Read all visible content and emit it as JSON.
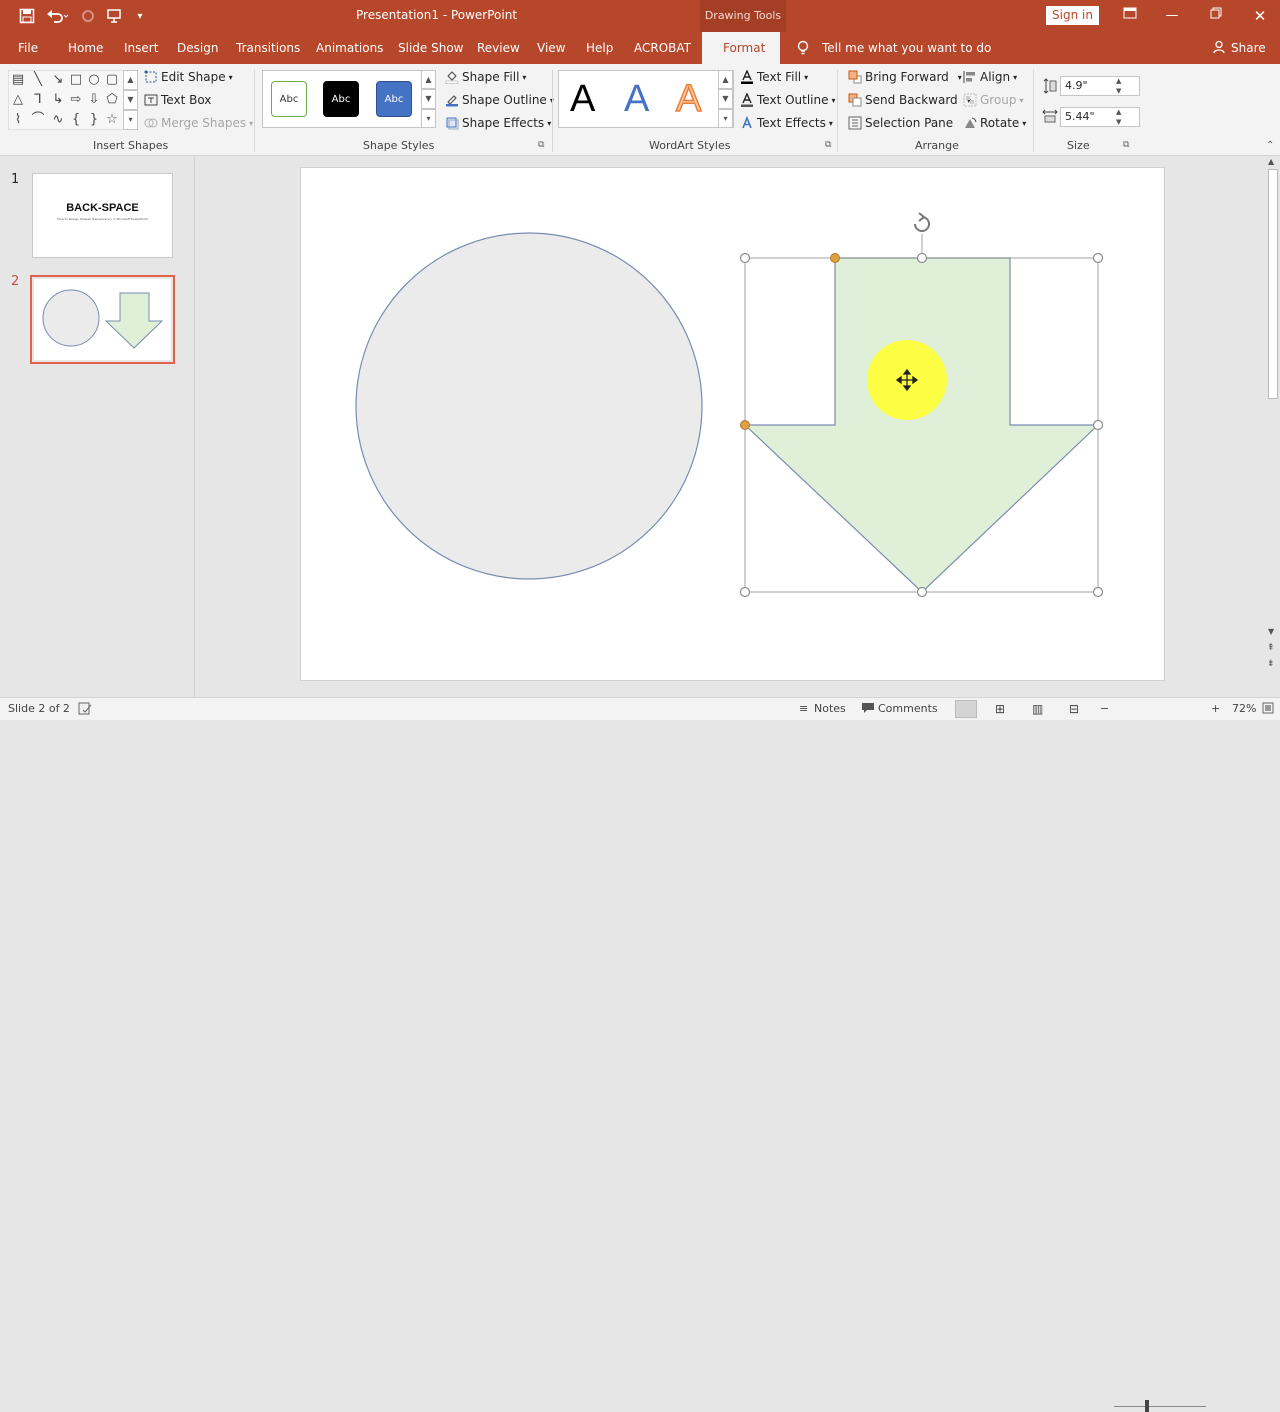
{
  "titlebar": {
    "document_title": "Presentation1  -  PowerPoint",
    "contextual_tab_header": "Drawing Tools",
    "sign_in": "Sign in",
    "qat_icons": [
      "save-icon",
      "undo-icon",
      "redo-icon",
      "present-icon",
      "customize-qat-icon"
    ],
    "window_icons": [
      "ribbon-display-icon",
      "minimize-icon",
      "restore-icon",
      "close-icon"
    ]
  },
  "tabs": [
    {
      "label": "File"
    },
    {
      "label": "Home"
    },
    {
      "label": "Insert"
    },
    {
      "label": "Design"
    },
    {
      "label": "Transitions"
    },
    {
      "label": "Animations"
    },
    {
      "label": "Slide Show"
    },
    {
      "label": "Review"
    },
    {
      "label": "View"
    },
    {
      "label": "Help"
    },
    {
      "label": "ACROBAT"
    },
    {
      "label": "Format"
    }
  ],
  "tell_me": "Tell me what you want to do",
  "share": "Share",
  "ribbon": {
    "insert_shapes": {
      "label": "Insert Shapes",
      "edit_shape": "Edit Shape",
      "text_box": "Text Box",
      "merge_shapes": "Merge Shapes"
    },
    "shape_styles": {
      "label": "Shape Styles",
      "preset": [
        "Abc",
        "Abc",
        "Abc"
      ],
      "shape_fill": "Shape Fill",
      "shape_outline": "Shape Outline",
      "shape_effects": "Shape Effects"
    },
    "wordart_styles": {
      "label": "WordArt Styles",
      "letters": [
        "A",
        "A",
        "A"
      ],
      "text_fill": "Text Fill",
      "text_outline": "Text Outline",
      "text_effects": "Text Effects"
    },
    "arrange": {
      "label": "Arrange",
      "bring_forward": "Bring Forward",
      "send_backward": "Send Backward",
      "selection_pane": "Selection Pane",
      "align": "Align",
      "group": "Group",
      "rotate": "Rotate"
    },
    "size": {
      "label": "Size",
      "height": "4.9\"",
      "width": "5.44\""
    }
  },
  "slides": [
    {
      "number": "1",
      "title": "BACK-SPACE",
      "subtitle": "How to Design Shapes Transparency in Microsoft PowerPoint"
    },
    {
      "number": "2"
    }
  ],
  "statusbar": {
    "slide_info": "Slide 2 of 2",
    "notes": "Notes",
    "comments": "Comments",
    "zoom": "72%"
  },
  "colors": {
    "accent": "#b7472a",
    "shape_circle_fill": "#ebebeb",
    "shape_outline": "#7a8bb0",
    "arrow_fill": "#e0efd8",
    "cursor_highlight": "#ffff33"
  }
}
